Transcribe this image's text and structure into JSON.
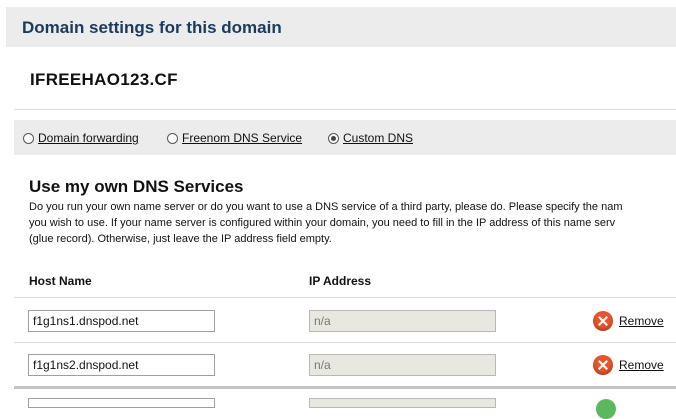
{
  "header": {
    "title": "Domain settings for this domain"
  },
  "domain": {
    "name": "IFREEHAO123.CF"
  },
  "options": [
    {
      "label": "Domain forwarding",
      "selected": false
    },
    {
      "label": "Freenom DNS Service",
      "selected": false
    },
    {
      "label": "Custom DNS",
      "selected": true
    }
  ],
  "section": {
    "title": "Use my own DNS Services",
    "description_lines": [
      "Do you run your own name server or do you want to use a DNS service of a third party, please do. Please specify the nam",
      "you wish to use. If your name server is configured within your domain, you need to fill in the IP address of this name serv",
      "(glue record). Otherwise, just leave the IP address field empty."
    ]
  },
  "table": {
    "headers": {
      "host": "Host Name",
      "ip": "IP Address"
    },
    "rows": [
      {
        "host": "f1g1ns1.dnspod.net",
        "ip": "n/a",
        "remove_label": "Remove"
      },
      {
        "host": "f1g1ns2.dnspod.net",
        "ip": "n/a",
        "remove_label": "Remove"
      }
    ]
  }
}
